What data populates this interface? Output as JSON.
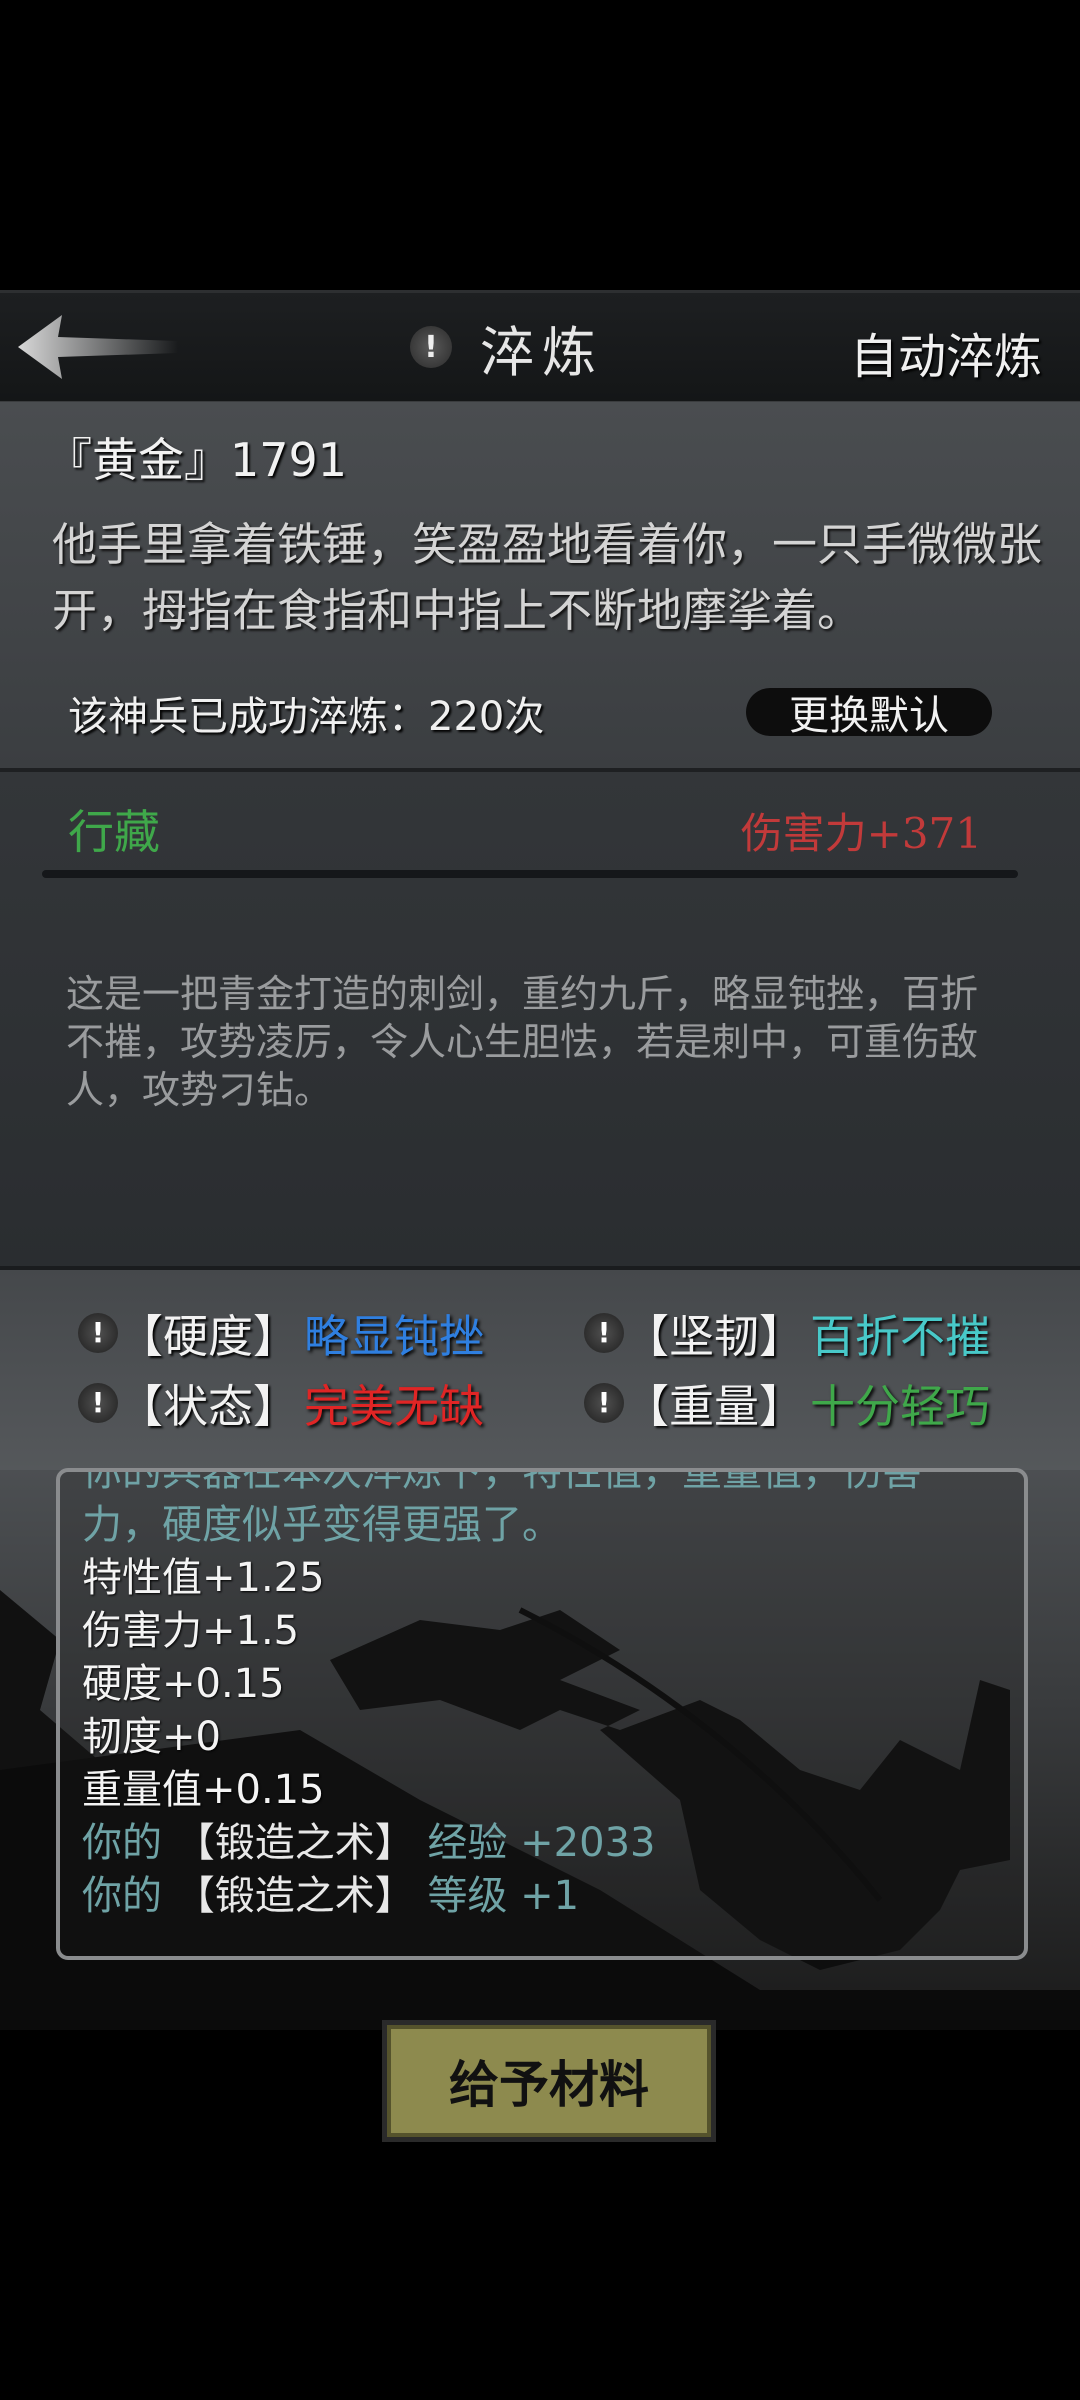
{
  "header": {
    "title": "淬炼",
    "auto_refine_label": "自动淬炼",
    "info_icon_text": "!"
  },
  "info": {
    "weapon_name": "『黄金』1791",
    "description": "他手里拿着铁锤，笑盈盈地看着你，一只手微微张开，拇指在食指和中指上不断地摩挲着。",
    "refine_count": "该神兵已成功淬炼：220次",
    "reset_default_label": "更换默认"
  },
  "weapon": {
    "kind": "行藏",
    "damage": "伤害力+371",
    "lore": "这是一把青金打造的刺剑，重约九斤，略显钝挫，百折不摧，攻势凌厉，令人心生胆怯，若是刺中，可重伤敌人，攻势刁钻。"
  },
  "stats": [
    {
      "label": "【硬度】",
      "value": "略显钝挫",
      "color": "#2f7fe0"
    },
    {
      "label": "【坚韧】",
      "value": "百折不摧",
      "color": "#48c9c9"
    },
    {
      "label": "【状态】",
      "value": "完美无缺",
      "color": "#e02525"
    },
    {
      "label": "【重量】",
      "value": "十分轻巧",
      "color": "#3fa84a"
    }
  ],
  "log": {
    "cut_line": "你的兵器在本次淬炼下，特性值，重量值，伤害",
    "line2": "力，硬度似乎变得更强了。",
    "trait": "特性值+1.25",
    "damage": "伤害力+1.5",
    "hardness": "硬度+0.15",
    "toughness": "韧度+0",
    "weight": "重量值+0.15",
    "exp_prefix": "你的",
    "skill": "【锻造之术】",
    "exp_suffix": "经验 +2033",
    "level_prefix": "你的",
    "level_suffix": "等级 +1"
  },
  "give_button_label": "给予材料"
}
